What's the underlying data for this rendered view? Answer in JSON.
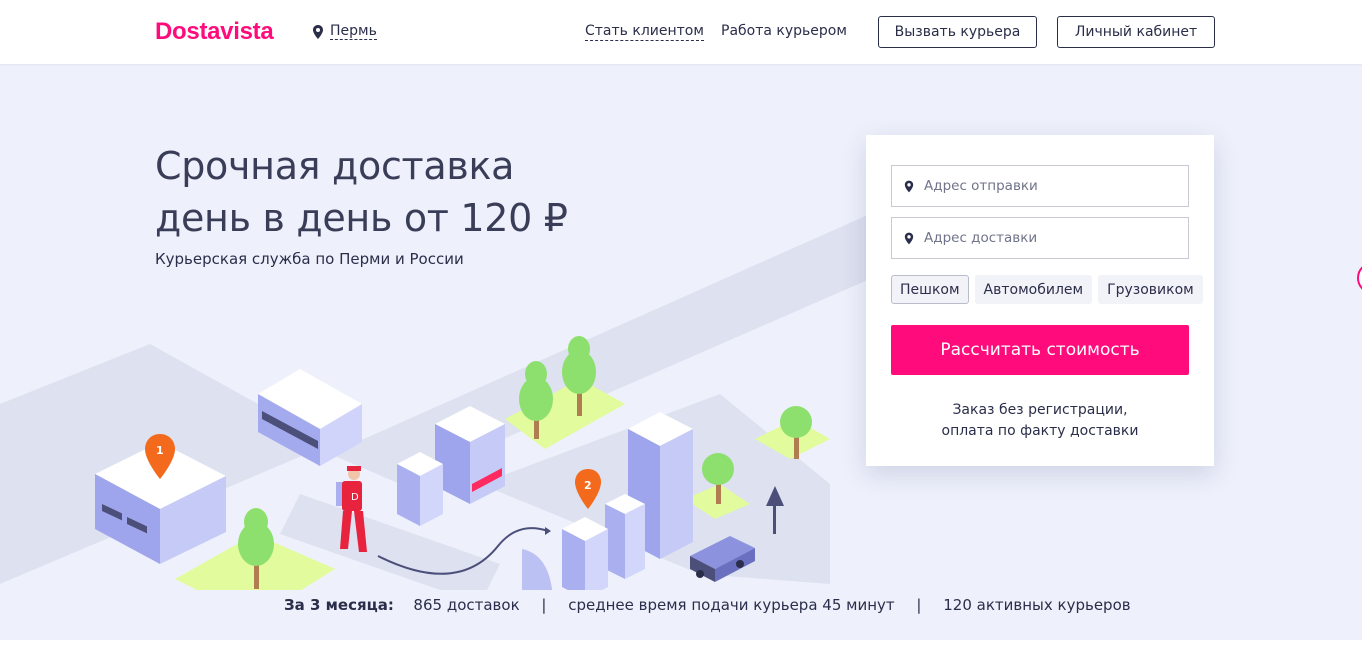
{
  "header": {
    "logo": "Dostavista",
    "city": "Пермь",
    "nav": {
      "become_client": "Стать клиентом",
      "courier_work": "Работа курьером"
    },
    "buttons": {
      "call_courier": "Вызвать курьера",
      "cabinet": "Личный кабинет"
    },
    "icons": {
      "city_pin": "map-pin-icon"
    }
  },
  "hero": {
    "title_line1": "Срочная доставка",
    "title_line2": "день в день от 120 ₽",
    "subtitle": "Курьерская служба по Перми и России",
    "illustration": {
      "pin_labels": [
        "1",
        "2"
      ],
      "courier_badge": "D"
    }
  },
  "form": {
    "from_placeholder": "Адрес отправки",
    "to_placeholder": "Адрес доставки",
    "modes": [
      "Пешком",
      "Автомобилем",
      "Грузовиком"
    ],
    "active_mode": "Пешком",
    "submit_label": "Рассчитать стоимость",
    "note_line1": "Заказ без регистрации,",
    "note_line2": "оплата по факту доставки"
  },
  "stats": {
    "prefix": "За 3 месяца:",
    "deliveries": "865 доставок",
    "avg_time": "среднее время подачи курьера 45 минут",
    "couriers": "120 активных курьеров",
    "separator": "|"
  },
  "colors": {
    "brand": "#ff0b7c",
    "text": "#2b2e4a",
    "hero_bg": "#eef1fb",
    "pin_orange": "#f36a1d",
    "grass": "#e2fb9c",
    "tree": "#8ee06e",
    "building": "#aab0ef"
  }
}
